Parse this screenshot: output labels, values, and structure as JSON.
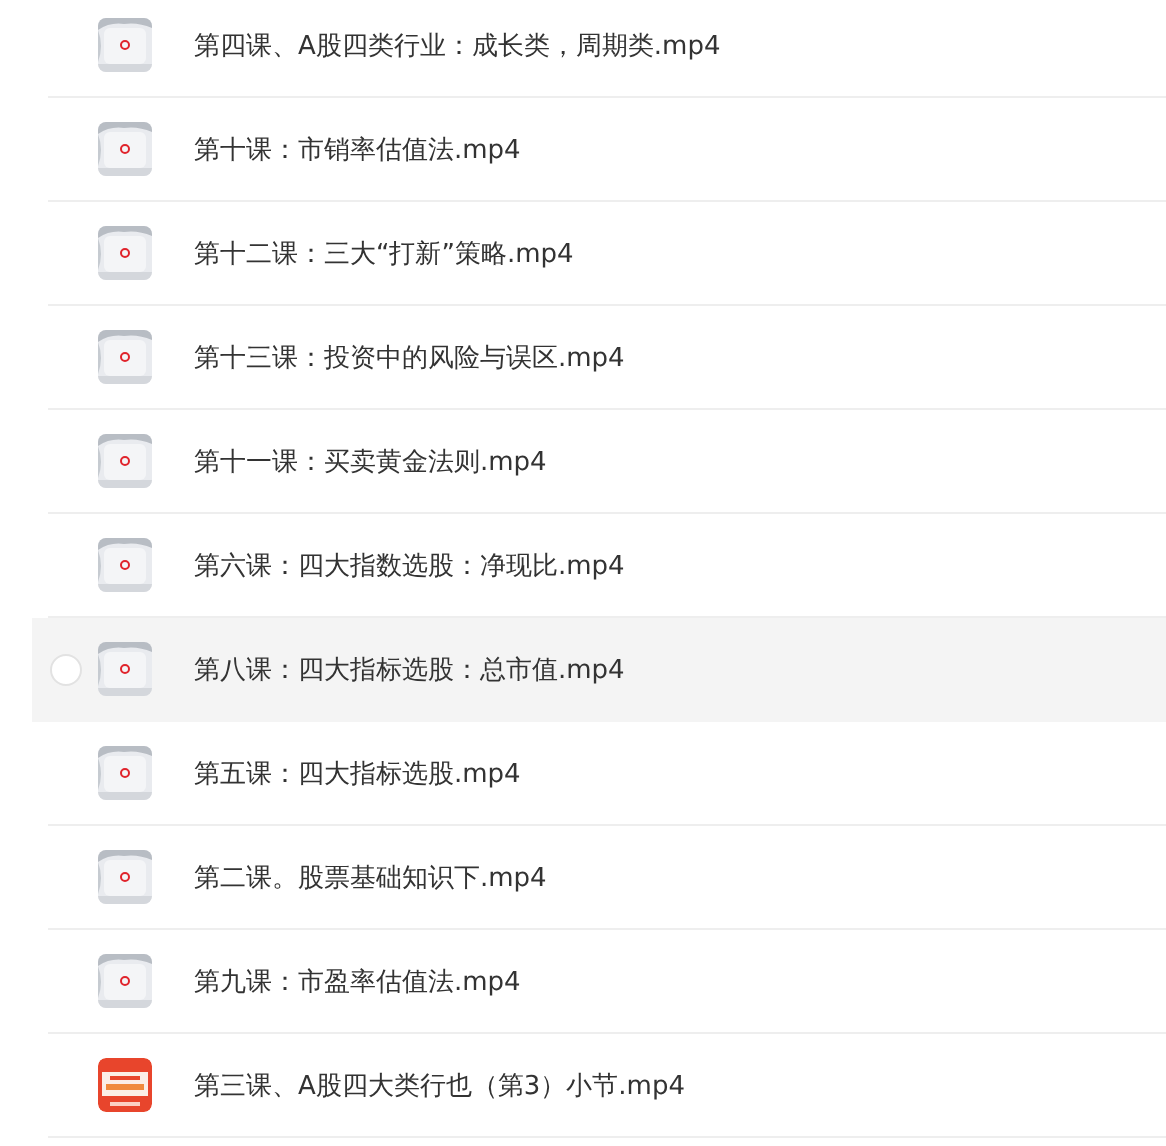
{
  "files": [
    {
      "name": "第四课、A股四类行业：成长类，周期类.mp4",
      "kind": "video",
      "hovered": false
    },
    {
      "name": "第十课：市销率估值法.mp4",
      "kind": "video",
      "hovered": false
    },
    {
      "name": "第十二课：三大“打新”策略.mp4",
      "kind": "video",
      "hovered": false
    },
    {
      "name": "第十三课：投资中的风险与误区.mp4",
      "kind": "video",
      "hovered": false
    },
    {
      "name": "第十一课：买卖黄金法则.mp4",
      "kind": "video",
      "hovered": false
    },
    {
      "name": "第六课：四大指数选股：净现比.mp4",
      "kind": "video",
      "hovered": false
    },
    {
      "name": "第八课：四大指标选股：总市值.mp4",
      "kind": "video",
      "hovered": true
    },
    {
      "name": "第五课：四大指标选股.mp4",
      "kind": "video",
      "hovered": false
    },
    {
      "name": "第二课。股票基础知识下.mp4",
      "kind": "video",
      "hovered": false
    },
    {
      "name": "第九课：市盈率估值法.mp4",
      "kind": "video",
      "hovered": false
    },
    {
      "name": "第三课、A股四大类行也（第3）小节.mp4",
      "kind": "poster",
      "hovered": false
    }
  ]
}
